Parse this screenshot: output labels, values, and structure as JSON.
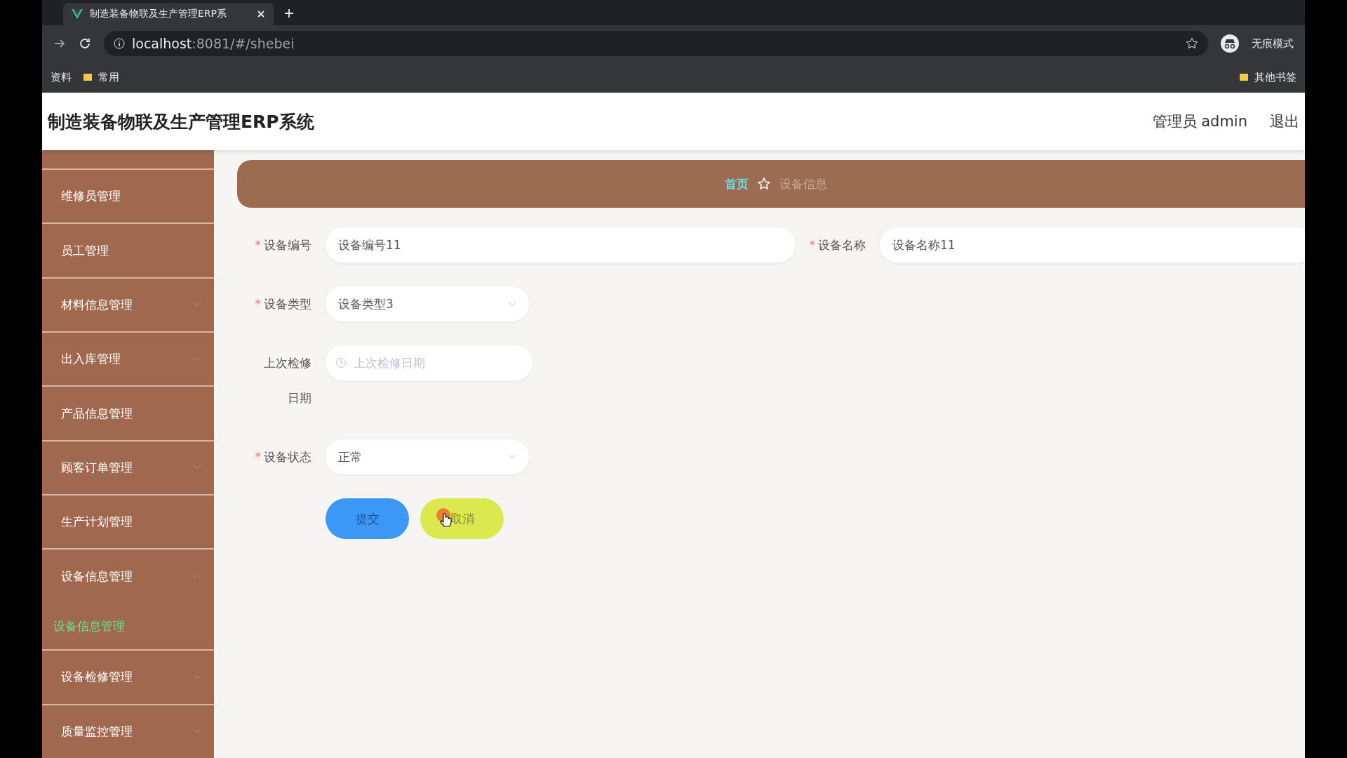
{
  "browser": {
    "tab_title": "制造装备物联及生产管理ERP系",
    "address_host": "localhost",
    "address_rest": ":8081/#/shebei",
    "profile": "无痕模式",
    "bookmarks": [
      "资料",
      "常用"
    ],
    "other_bookmarks": "其他书签"
  },
  "header": {
    "title": "制造装备物联及生产管理ERP系统",
    "user": "管理员 admin",
    "logout": "退出"
  },
  "sidebar": {
    "items": [
      {
        "label": "维修员管理",
        "kind": "link"
      },
      {
        "label": "员工管理",
        "kind": "link"
      },
      {
        "label": "材料信息管理",
        "kind": "group",
        "expanded": false
      },
      {
        "label": "出入库管理",
        "kind": "group",
        "expanded": false
      },
      {
        "label": "产品信息管理",
        "kind": "link"
      },
      {
        "label": "顾客订单管理",
        "kind": "group",
        "expanded": false
      },
      {
        "label": "生产计划管理",
        "kind": "link"
      },
      {
        "label": "设备信息管理",
        "kind": "group",
        "expanded": true,
        "children": [
          {
            "label": "设备信息管理",
            "selected": true
          }
        ]
      },
      {
        "label": "设备检修管理",
        "kind": "group",
        "expanded": false
      },
      {
        "label": "质量监控管理",
        "kind": "group",
        "expanded": false
      }
    ]
  },
  "breadcrumb": [
    "首页",
    "设备信息"
  ],
  "form": {
    "required_mark": "*",
    "rows": [
      [
        {
          "label": "设备编号",
          "required": true,
          "kind": "input",
          "value": "设备编号11"
        },
        {
          "label": "设备名称",
          "required": true,
          "kind": "input",
          "value": "设备名称11"
        }
      ],
      [
        {
          "label": "设备类型",
          "required": true,
          "kind": "select",
          "value": "设备类型3"
        }
      ],
      [
        {
          "label": "上次检修日期",
          "required": false,
          "kind": "date",
          "placeholder": "上次检修日期"
        }
      ],
      [
        {
          "label": "设备状态",
          "required": true,
          "kind": "select",
          "value": "正常"
        }
      ]
    ],
    "buttons": [
      {
        "label": "提交",
        "kind": "primary"
      },
      {
        "label": "取消",
        "kind": "cancel"
      }
    ]
  }
}
